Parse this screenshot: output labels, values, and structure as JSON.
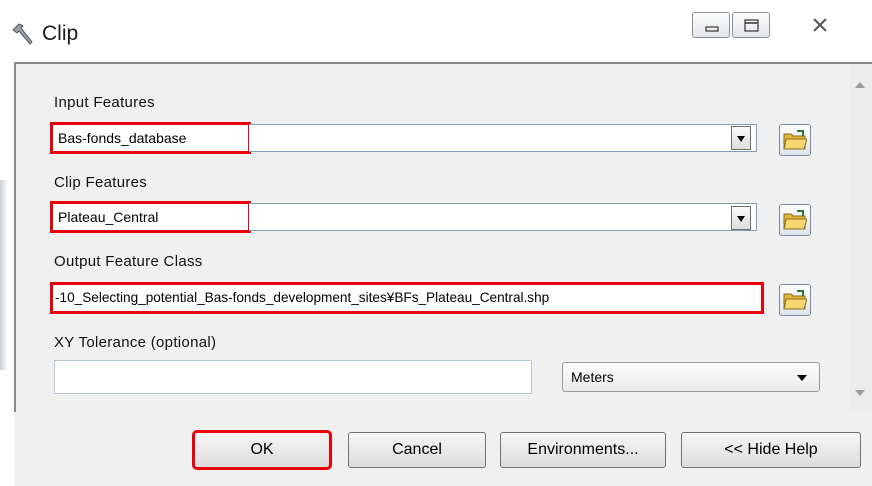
{
  "window": {
    "title": "Clip"
  },
  "form": {
    "input_features": {
      "label": "Input Features",
      "value": "Bas-fonds_database"
    },
    "clip_features": {
      "label": "Clip Features",
      "value": "Plateau_Central"
    },
    "output_feature_class": {
      "label": "Output Feature Class",
      "value": "-10_Selecting_potential_Bas-fonds_development_sites¥BFs_Plateau_Central.shp"
    },
    "xy_tolerance": {
      "label": "XY Tolerance (optional)",
      "value": "",
      "unit": "Meters"
    }
  },
  "buttons": {
    "ok": "OK",
    "cancel": "Cancel",
    "environments": "Environments...",
    "hide_help": "<< Hide Help"
  },
  "colors": {
    "highlight": "#e8000b",
    "dialog_bg": "#f0f0f0"
  },
  "icons": [
    "hammer-icon",
    "minimize-icon",
    "maximize-icon",
    "close-icon",
    "open-folder-icon",
    "dropdown-arrow-icon"
  ]
}
